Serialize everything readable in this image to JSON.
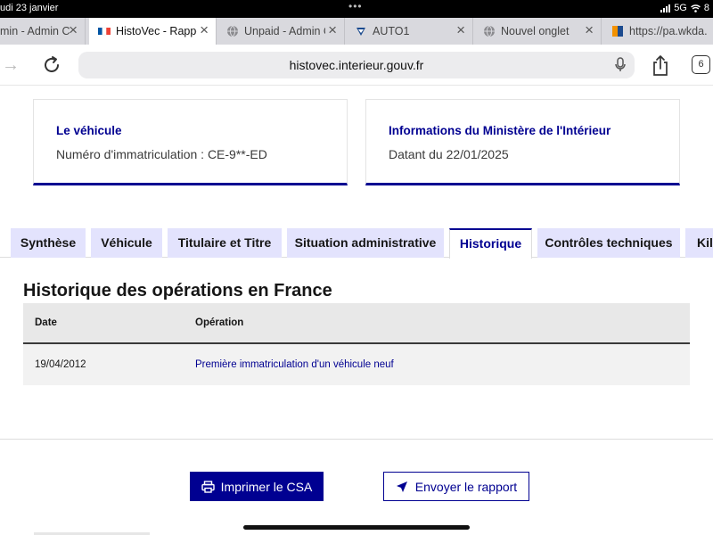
{
  "status_bar": {
    "time": "udi 23 janvier",
    "network": "5G",
    "battery": "8"
  },
  "browser_tabs": [
    {
      "label": "min - Admin C",
      "icon": "favicon-admin-icon",
      "active": false
    },
    {
      "label": "HistoVec - Rappo",
      "icon": "france-flag-icon",
      "active": true
    },
    {
      "label": "Unpaid - Admin C",
      "icon": "globe-icon",
      "active": false
    },
    {
      "label": "AUTO1",
      "icon": "auto1-logo-icon",
      "active": false
    },
    {
      "label": "Nouvel onglet",
      "icon": "globe-icon",
      "active": false
    },
    {
      "label": "https://pa.wkda.",
      "icon": "wkda-logo-icon",
      "active": false
    }
  ],
  "address_bar": {
    "url": "histovec.interieur.gouv.fr",
    "tabs_count": "6"
  },
  "cards": [
    {
      "title": "Le véhicule",
      "text": "Numéro d'immatriculation : CE-9**-ED"
    },
    {
      "title": "Informations du Ministère de l'Intérieur",
      "text": "Datant du 22/01/2025"
    }
  ],
  "nav_tabs": [
    {
      "label": "Synthèse",
      "active": false
    },
    {
      "label": "Véhicule",
      "active": false
    },
    {
      "label": "Titulaire et Titre",
      "active": false
    },
    {
      "label": "Situation administrative",
      "active": false
    },
    {
      "label": "Historique",
      "active": true
    },
    {
      "label": "Contrôles techniques",
      "active": false
    },
    {
      "label": "Kilo",
      "active": false
    }
  ],
  "history": {
    "title": "Historique des opérations en France",
    "columns": [
      "Date",
      "Opération"
    ],
    "rows": [
      {
        "date": "19/04/2012",
        "operation": "Première immatriculation d'un véhicule neuf"
      }
    ]
  },
  "actions": {
    "print_label": "Imprimer le CSA",
    "send_label": "Envoyer le rapport"
  },
  "colors": {
    "primary": "#000091",
    "tab_bg": "#e3e3fd",
    "table_header_bg": "#e8e8e8"
  }
}
